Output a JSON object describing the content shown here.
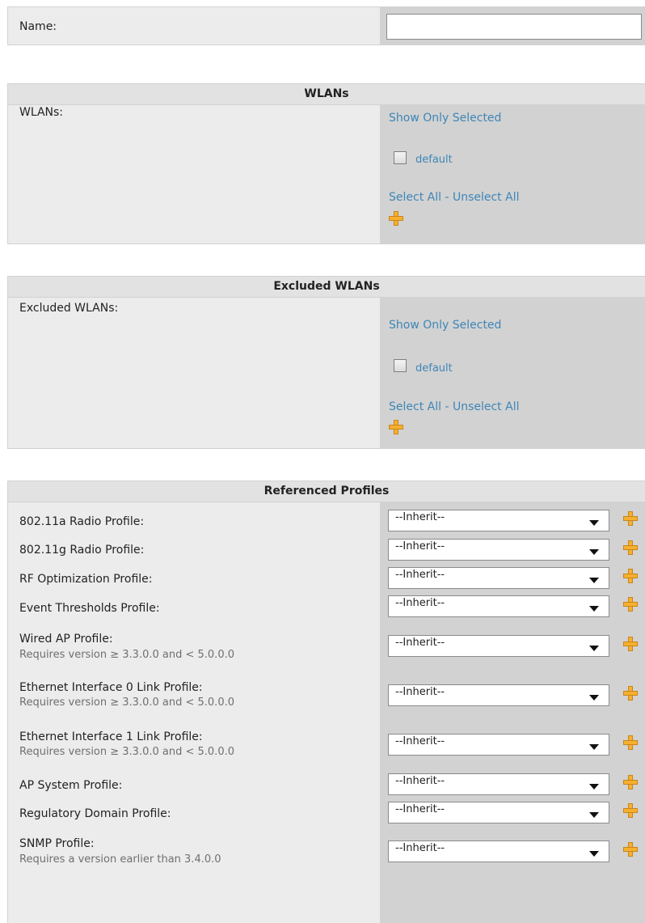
{
  "name_section": {
    "label": "Name:",
    "value": ""
  },
  "wlans": {
    "header": "WLANs",
    "label": "WLANs:",
    "show_only_selected": "Show Only Selected",
    "checkbox_label": "default",
    "select_all": "Select All",
    "separator": " - ",
    "unselect_all": "Unselect All"
  },
  "excluded_wlans": {
    "header": "Excluded WLANs",
    "label": "Excluded WLANs:",
    "show_only_selected": "Show Only Selected",
    "checkbox_label": "default",
    "select_all": "Select All",
    "separator": " - ",
    "unselect_all": "Unselect All"
  },
  "referenced_profiles": {
    "header": "Referenced Profiles",
    "rows": [
      {
        "label": "802.11a Radio Profile:",
        "sublabel": "",
        "value": "--Inherit--"
      },
      {
        "label": "802.11g Radio Profile:",
        "sublabel": "",
        "value": "--Inherit--"
      },
      {
        "label": "RF Optimization Profile:",
        "sublabel": "",
        "value": "--Inherit--"
      },
      {
        "label": "Event Thresholds Profile:",
        "sublabel": "",
        "value": "--Inherit--"
      },
      {
        "label": "Wired AP Profile:",
        "sublabel": "Requires version ≥ 3.3.0.0 and < 5.0.0.0",
        "value": "--Inherit--"
      },
      {
        "label": "Ethernet Interface 0 Link Profile:",
        "sublabel": "Requires version ≥ 3.3.0.0 and < 5.0.0.0",
        "value": "--Inherit--"
      },
      {
        "label": "Ethernet Interface 1 Link Profile:",
        "sublabel": "Requires version ≥ 3.3.0.0 and < 5.0.0.0",
        "value": "--Inherit--"
      },
      {
        "label": "AP System Profile:",
        "sublabel": "",
        "value": "--Inherit--"
      },
      {
        "label": "Regulatory Domain Profile:",
        "sublabel": "",
        "value": "--Inherit--"
      },
      {
        "label": "SNMP Profile:",
        "sublabel": "Requires a version earlier than 3.4.0.0",
        "value": "--Inherit--"
      }
    ]
  },
  "colors": {
    "link": "#3e86b7",
    "panel_bg": "#ececec",
    "input_col_bg": "#d2d2d2",
    "plus_icon": "#f6b02e"
  }
}
